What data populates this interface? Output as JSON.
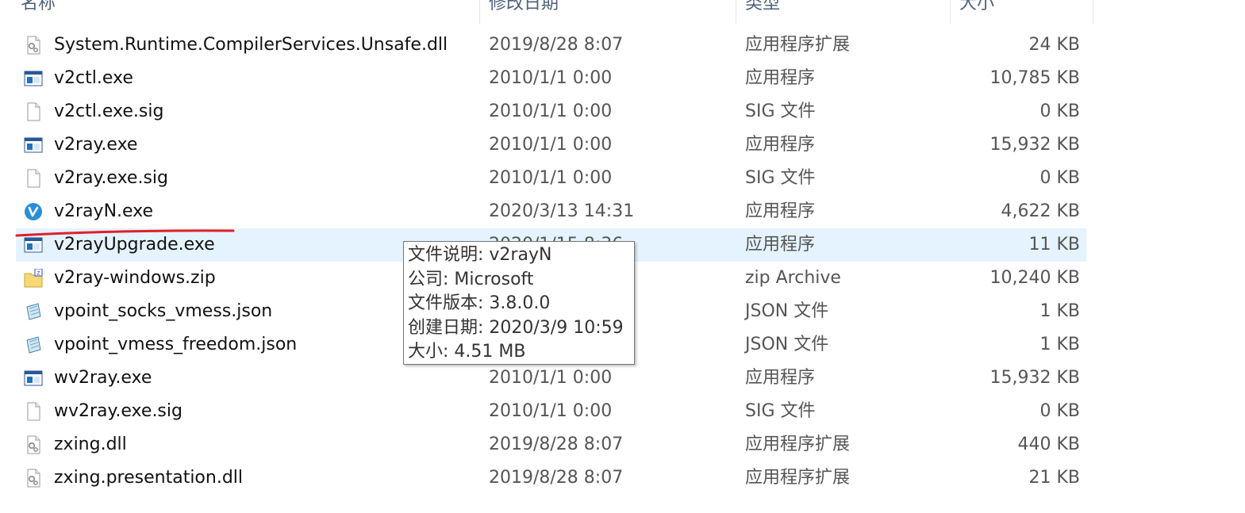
{
  "columns": {
    "name": "名称",
    "date": "修改日期",
    "type": "类型",
    "size": "大小"
  },
  "files": [
    {
      "name": "System.Runtime.CompilerServices.Unsafe.dll",
      "date": "2019/8/28 8:07",
      "type": "应用程序扩展",
      "size": "24 KB",
      "icon": "dll-icon"
    },
    {
      "name": "v2ctl.exe",
      "date": "2010/1/1 0:00",
      "type": "应用程序",
      "size": "10,785 KB",
      "icon": "exe-icon"
    },
    {
      "name": "v2ctl.exe.sig",
      "date": "2010/1/1 0:00",
      "type": "SIG 文件",
      "size": "0 KB",
      "icon": "file-icon"
    },
    {
      "name": "v2ray.exe",
      "date": "2010/1/1 0:00",
      "type": "应用程序",
      "size": "15,932 KB",
      "icon": "exe-icon"
    },
    {
      "name": "v2ray.exe.sig",
      "date": "2010/1/1 0:00",
      "type": "SIG 文件",
      "size": "0 KB",
      "icon": "file-icon"
    },
    {
      "name": "v2rayN.exe",
      "date": "2020/3/13 14:31",
      "type": "应用程序",
      "size": "4,622 KB",
      "icon": "v2rayn-icon"
    },
    {
      "name": "v2rayUpgrade.exe",
      "date": "2020/1/15 8:36",
      "type": "应用程序",
      "size": "11 KB",
      "icon": "exe-icon"
    },
    {
      "name": "v2ray-windows.zip",
      "date": "",
      "type": "zip Archive",
      "size": "10,240 KB",
      "icon": "zip-icon"
    },
    {
      "name": "vpoint_socks_vmess.json",
      "date": "",
      "type": "JSON 文件",
      "size": "1 KB",
      "icon": "json-icon"
    },
    {
      "name": "vpoint_vmess_freedom.json",
      "date": "",
      "type": "JSON 文件",
      "size": "1 KB",
      "icon": "json-icon"
    },
    {
      "name": "wv2ray.exe",
      "date": "2010/1/1 0:00",
      "type": "应用程序",
      "size": "15,932 KB",
      "icon": "exe-icon"
    },
    {
      "name": "wv2ray.exe.sig",
      "date": "2010/1/1 0:00",
      "type": "SIG 文件",
      "size": "0 KB",
      "icon": "file-icon"
    },
    {
      "name": "zxing.dll",
      "date": "2019/8/28 8:07",
      "type": "应用程序扩展",
      "size": "440 KB",
      "icon": "dll-icon"
    },
    {
      "name": "zxing.presentation.dll",
      "date": "2019/8/28 8:07",
      "type": "应用程序扩展",
      "size": "21 KB",
      "icon": "dll-icon"
    }
  ],
  "hovered_index": 6,
  "tooltip": {
    "lines": [
      "文件说明: v2rayN",
      "公司: Microsoft",
      "文件版本: 3.8.0.0",
      "创建日期: 2020/3/9 10:59",
      "大小: 4.51 MB"
    ]
  },
  "colors": {
    "hover_bg": "#e5f3ff",
    "annotation_underline": "#e0202a",
    "header_text": "#4c607a"
  }
}
